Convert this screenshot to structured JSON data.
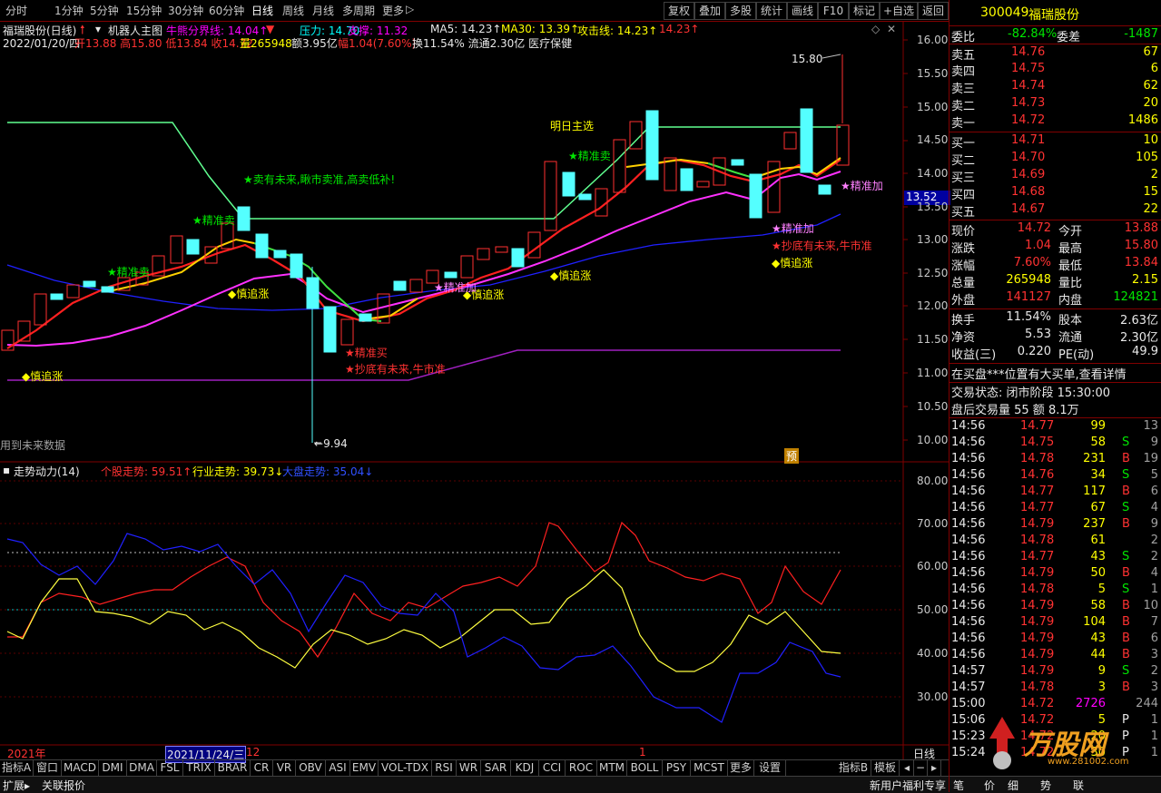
{
  "toolbar": {
    "periods": [
      "分时",
      "1分钟",
      "5分钟",
      "15分钟",
      "30分钟",
      "60分钟",
      "日线",
      "周线",
      "月线",
      "多周期",
      "更多"
    ],
    "active_period": "日线",
    "more_arrow": "▷",
    "buttons": [
      "复权",
      "叠加",
      "多股",
      "统计",
      "画线",
      "F10",
      "标记",
      "+自选",
      "返回"
    ]
  },
  "chart": {
    "stock_title": "福瑞股份(日线)",
    "main_indicator": "机器人主图",
    "bull_bear_line": "牛熊分界线: 14.04↑",
    "pressure": "压力: 14.70",
    "support": "支撑: 11.32",
    "ma5": "MA5: 14.23↑",
    "ma30": "MA30: 13.39↑",
    "attack_line": "攻击线: 14.23↑",
    "attack_value": "14.23↑",
    "date": "2022/01/20/四",
    "ohlc": "开13.88 高15.80 低13.84 收14.72",
    "volume": "量265948",
    "amount": "额3.95亿",
    "change": "幅1.04(7.60%)",
    "turnover": "换11.54% 流通2.30亿 医疗保健",
    "high_marker": "15.80",
    "low_marker": "9.94",
    "future_data_note": "用到未来数据",
    "current_price_tag": "13.52",
    "pre_tag": "预",
    "signals": {
      "sell_future": "卖有未来,瞅市卖准,高卖低补!",
      "precise_sell_1": "精准卖",
      "precise_sell_2": "精准卖",
      "precise_sell_3": "精准卖",
      "precise_buy": "精准买",
      "bottom_1": "抄底有未来,牛市准",
      "bottom_2": "抄底有未来,牛市准",
      "chase_1": "慎追涨",
      "chase_2": "慎追涨",
      "chase_3": "慎追涨",
      "chase_4": "慎追涨",
      "chase_5": "慎追涨",
      "precise_add_1": "精准加",
      "precise_add_2": "精准加",
      "precise_add_3": "精准加",
      "tomorrow_pick": "明日主选"
    },
    "y_axis": [
      "16.00",
      "15.50",
      "15.00",
      "14.50",
      "14.00",
      "13.50",
      "13.00",
      "12.50",
      "12.00",
      "11.50",
      "11.00",
      "10.50",
      "10.00"
    ]
  },
  "sub_chart": {
    "title": "走势动力(14)",
    "stock_trend": "个股走势: 59.51↑",
    "industry_trend": "行业走势: 39.73↓",
    "market_trend": "大盘走势: 35.04↓",
    "y_axis": [
      "80.00",
      "70.00",
      "60.00",
      "50.00",
      "40.00",
      "30.00"
    ]
  },
  "x_axis": {
    "year": "2021年",
    "cursor_date": "2021/11/24/三",
    "month_12": "12",
    "month_1": "1",
    "period_label": "日线"
  },
  "tabs": [
    "指标A",
    "窗口",
    "MACD",
    "DMI",
    "DMA",
    "FSL",
    "TRIX",
    "BRAR",
    "CR",
    "VR",
    "OBV",
    "ASI",
    "EMV",
    "VOL-TDX",
    "RSI",
    "WR",
    "SAR",
    "KDJ",
    "CCI",
    "ROC",
    "MTM",
    "BOLL",
    "PSY",
    "MCST",
    "更多",
    "设置"
  ],
  "tabs_right": [
    "指标B",
    "模板"
  ],
  "status": {
    "left": [
      "扩展▸",
      "关联报价"
    ],
    "right": "新用户福利专享",
    "brand": "万股网",
    "brand_url": "www.281002.com"
  },
  "quote": {
    "code": "300049",
    "name": "福瑞股份",
    "weibi_label": "委比",
    "weibi": "-82.84%",
    "weicha_label": "委差",
    "weicha": "-1487",
    "asks": [
      {
        "label": "卖五",
        "price": "14.76",
        "vol": "67"
      },
      {
        "label": "卖四",
        "price": "14.75",
        "vol": "6"
      },
      {
        "label": "卖三",
        "price": "14.74",
        "vol": "62"
      },
      {
        "label": "卖二",
        "price": "14.73",
        "vol": "20"
      },
      {
        "label": "卖一",
        "price": "14.72",
        "vol": "1486"
      }
    ],
    "bids": [
      {
        "label": "买一",
        "price": "14.71",
        "vol": "10"
      },
      {
        "label": "买二",
        "price": "14.70",
        "vol": "105"
      },
      {
        "label": "买三",
        "price": "14.69",
        "vol": "2"
      },
      {
        "label": "买四",
        "price": "14.68",
        "vol": "15"
      },
      {
        "label": "买五",
        "price": "14.67",
        "vol": "22"
      }
    ],
    "stats": [
      {
        "l1": "现价",
        "v1": "14.72",
        "l2": "今开",
        "v2": "13.88"
      },
      {
        "l1": "涨跌",
        "v1": "1.04",
        "l2": "最高",
        "v2": "15.80"
      },
      {
        "l1": "涨幅",
        "v1": "7.60%",
        "l2": "最低",
        "v2": "13.84"
      },
      {
        "l1": "总量",
        "v1": "265948",
        "l2": "量比",
        "v2": "2.15"
      },
      {
        "l1": "外盘",
        "v1": "141127",
        "l2": "内盘",
        "v2": "124821"
      }
    ],
    "stats2": [
      {
        "l1": "换手",
        "v1": "11.54%",
        "l2": "股本",
        "v2": "2.63亿"
      },
      {
        "l1": "净资",
        "v1": "5.53",
        "l2": "流通",
        "v2": "2.30亿"
      },
      {
        "l1": "收益(三)",
        "v1": "0.220",
        "l2": "PE(动)",
        "v2": "49.9"
      }
    ],
    "notice": "在买盘***位置有大买单,查看详情",
    "trade_status": "交易状态: 闭市阶段 15:30:00",
    "after_hours": "盘后交易量 55 额 8.1万"
  },
  "ticks": [
    {
      "t": "14:56",
      "p": "14.77",
      "v": "99",
      "s": "",
      "n": "13"
    },
    {
      "t": "14:56",
      "p": "14.75",
      "v": "58",
      "s": "S",
      "n": "9"
    },
    {
      "t": "14:56",
      "p": "14.78",
      "v": "231",
      "s": "B",
      "n": "19"
    },
    {
      "t": "14:56",
      "p": "14.76",
      "v": "34",
      "s": "S",
      "n": "5"
    },
    {
      "t": "14:56",
      "p": "14.77",
      "v": "117",
      "s": "B",
      "n": "6"
    },
    {
      "t": "14:56",
      "p": "14.77",
      "v": "67",
      "s": "S",
      "n": "4"
    },
    {
      "t": "14:56",
      "p": "14.79",
      "v": "237",
      "s": "B",
      "n": "9"
    },
    {
      "t": "14:56",
      "p": "14.78",
      "v": "61",
      "s": "",
      "n": "2"
    },
    {
      "t": "14:56",
      "p": "14.77",
      "v": "43",
      "s": "S",
      "n": "2"
    },
    {
      "t": "14:56",
      "p": "14.79",
      "v": "50",
      "s": "B",
      "n": "4"
    },
    {
      "t": "14:56",
      "p": "14.78",
      "v": "5",
      "s": "S",
      "n": "1"
    },
    {
      "t": "14:56",
      "p": "14.79",
      "v": "58",
      "s": "B",
      "n": "10"
    },
    {
      "t": "14:56",
      "p": "14.79",
      "v": "104",
      "s": "B",
      "n": "7"
    },
    {
      "t": "14:56",
      "p": "14.79",
      "v": "43",
      "s": "B",
      "n": "6"
    },
    {
      "t": "14:56",
      "p": "14.79",
      "v": "44",
      "s": "B",
      "n": "3"
    },
    {
      "t": "14:57",
      "p": "14.79",
      "v": "9",
      "s": "S",
      "n": "2"
    },
    {
      "t": "14:57",
      "p": "14.78",
      "v": "3",
      "s": "B",
      "n": "3"
    },
    {
      "t": "15:00",
      "p": "14.72",
      "v": "2726",
      "s": "",
      "n": "244"
    },
    {
      "t": "15:06",
      "p": "14.72",
      "v": "5",
      "s": "P",
      "n": "1"
    },
    {
      "t": "15:23",
      "p": "14.72",
      "v": "20",
      "s": "P",
      "n": "1"
    },
    {
      "t": "15:24",
      "p": "14.72",
      "v": "30",
      "s": "P",
      "n": "1"
    }
  ],
  "rp_tabs": [
    "笔",
    "价",
    "细",
    "势",
    "联"
  ]
}
